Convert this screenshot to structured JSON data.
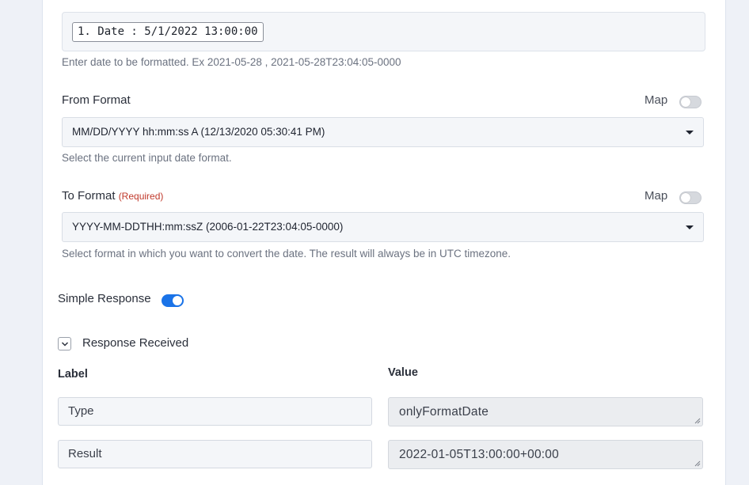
{
  "date_input": {
    "value": "1. Date : 5/1/2022 13:00:00",
    "hint": "Enter date to be formatted. Ex 2021-05-28 , 2021-05-28T23:04:05-0000"
  },
  "from_format": {
    "label": "From Format",
    "map_label": "Map",
    "map_enabled": false,
    "selected": "MM/DD/YYYY hh:mm:ss A (12/13/2020 05:30:41 PM)",
    "hint": "Select the current input date format."
  },
  "to_format": {
    "label": "To Format",
    "required": "(Required)",
    "map_label": "Map",
    "map_enabled": false,
    "selected": "YYYY-MM-DDTHH:mm:ssZ (2006-01-22T23:04:05-0000)",
    "hint": "Select format in which you want to convert the date. The result will always be in UTC timezone."
  },
  "simple_response": {
    "label": "Simple Response",
    "enabled": true
  },
  "response": {
    "title": "Response Received",
    "label_header": "Label",
    "value_header": "Value",
    "rows": [
      {
        "label": "Type",
        "value": "onlyFormatDate"
      },
      {
        "label": "Result",
        "value": "2022-01-05T13:00:00+00:00"
      }
    ]
  }
}
